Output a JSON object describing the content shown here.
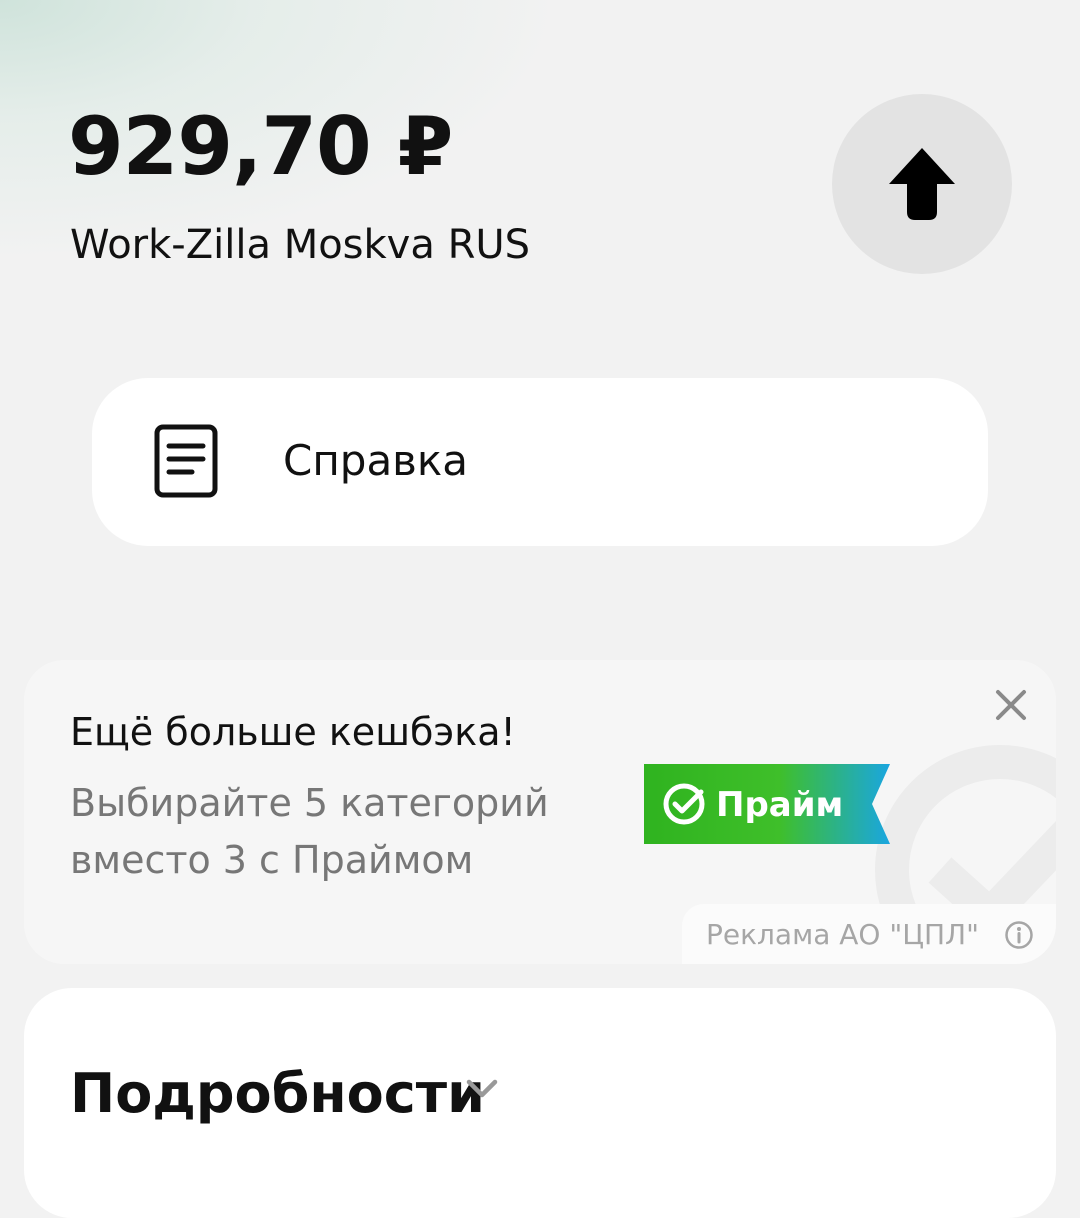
{
  "transaction": {
    "amount": "929,70 ₽",
    "merchant": "Work-Zilla Moskva RUS"
  },
  "actions": {
    "spravka_label": "Справка"
  },
  "promo": {
    "title": "Ещё больше кешбэка!",
    "subtitle_line1": "Выбирайте 5 категорий",
    "subtitle_line2": "вместо 3 с Праймом",
    "badge_label": "Прайм",
    "ad_label": "Реклама АО \"ЦПЛ\""
  },
  "details": {
    "title": "Подробности"
  },
  "colors": {
    "badge_gradient_start": "#2fb31f",
    "badge_gradient_end": "#1aa6e0"
  },
  "icons": {
    "up": "arrow-up-icon",
    "document": "document-icon",
    "close": "close-icon",
    "info": "info-icon",
    "chevron": "chevron-down-icon",
    "check": "check-circle-icon"
  }
}
